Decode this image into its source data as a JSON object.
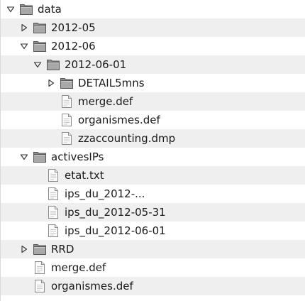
{
  "tree": {
    "rows": [
      {
        "label": "data",
        "depth": 0,
        "kind": "folder",
        "expander": "expanded",
        "icon": "folder-icon"
      },
      {
        "label": "2012-05",
        "depth": 1,
        "kind": "folder",
        "expander": "collapsed",
        "icon": "folder-icon"
      },
      {
        "label": "2012-06",
        "depth": 1,
        "kind": "folder",
        "expander": "expanded",
        "icon": "folder-icon"
      },
      {
        "label": "2012-06-01",
        "depth": 2,
        "kind": "folder",
        "expander": "expanded",
        "icon": "folder-icon"
      },
      {
        "label": "DETAIL5mns",
        "depth": 3,
        "kind": "folder",
        "expander": "collapsed",
        "icon": "folder-icon"
      },
      {
        "label": "merge.def",
        "depth": 3,
        "kind": "file",
        "expander": "none",
        "icon": "file-icon"
      },
      {
        "label": "organismes.def",
        "depth": 3,
        "kind": "file",
        "expander": "none",
        "icon": "file-icon"
      },
      {
        "label": "zzaccounting.dmp",
        "depth": 3,
        "kind": "file",
        "expander": "none",
        "icon": "file-icon"
      },
      {
        "label": "activesIPs",
        "depth": 1,
        "kind": "folder",
        "expander": "expanded",
        "icon": "folder-icon"
      },
      {
        "label": "etat.txt",
        "depth": 2,
        "kind": "file",
        "expander": "none",
        "icon": "file-icon"
      },
      {
        "label": "ips_du_2012-...",
        "depth": 2,
        "kind": "file",
        "expander": "none",
        "icon": "file-icon"
      },
      {
        "label": "ips_du_2012-05-31",
        "depth": 2,
        "kind": "file",
        "expander": "none",
        "icon": "file-icon"
      },
      {
        "label": "ips_du_2012-06-01",
        "depth": 2,
        "kind": "file",
        "expander": "none",
        "icon": "file-icon"
      },
      {
        "label": "RRD",
        "depth": 1,
        "kind": "folder",
        "expander": "collapsed",
        "icon": "folder-icon"
      },
      {
        "label": "merge.def",
        "depth": 1,
        "kind": "file",
        "expander": "none",
        "icon": "file-icon"
      },
      {
        "label": "organismes.def",
        "depth": 1,
        "kind": "file",
        "expander": "none",
        "icon": "file-icon"
      }
    ]
  },
  "colors": {
    "alt_row": "#efefef",
    "folder_fill": "#a8a8a8",
    "folder_tab": "#909090",
    "folder_stroke": "#555555",
    "file_fill": "#fbfbfb",
    "file_stroke": "#8a8a8a",
    "expander": "#333333"
  }
}
